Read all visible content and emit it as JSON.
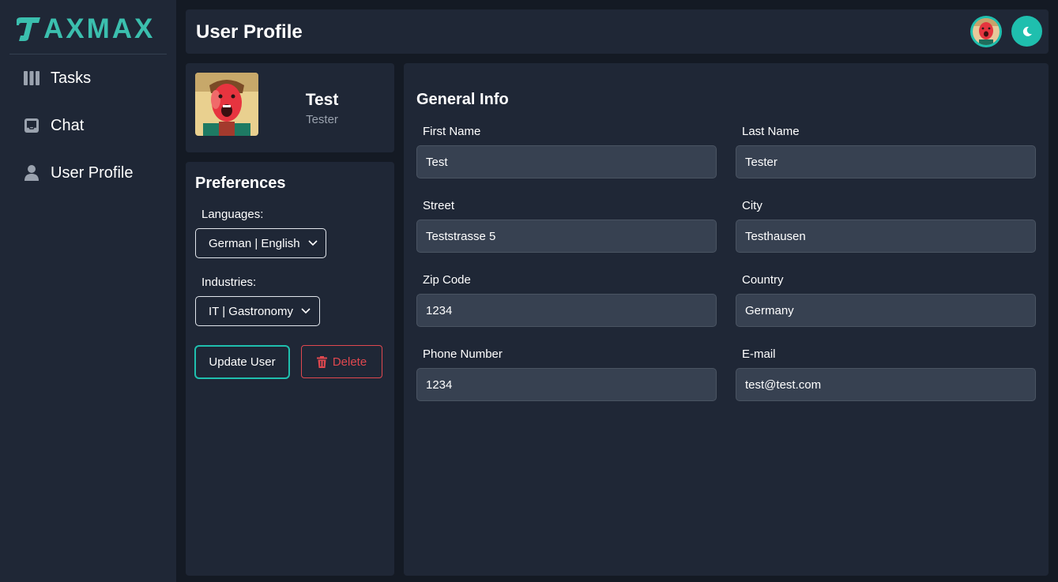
{
  "app": {
    "logo_text": "AXMAX",
    "accent_color": "#1fbfae",
    "danger_color": "#e0484f"
  },
  "sidebar": {
    "items": [
      {
        "label": "Tasks",
        "icon": "columns-icon"
      },
      {
        "label": "Chat",
        "icon": "inbox-icon"
      },
      {
        "label": "User Profile",
        "icon": "user-icon"
      }
    ]
  },
  "header": {
    "title": "User Profile",
    "theme_icon": "moon-icon"
  },
  "profile": {
    "name": "Test",
    "role": "Tester"
  },
  "preferences": {
    "title": "Preferences",
    "languages_label": "Languages:",
    "languages_value": "German | English",
    "industries_label": "Industries:",
    "industries_value": "IT | Gastronomy",
    "update_label": "Update User",
    "delete_label": "Delete"
  },
  "general_info": {
    "title": "General Info",
    "fields": [
      {
        "label": "First Name",
        "value": "Test"
      },
      {
        "label": "Last Name",
        "value": "Tester"
      },
      {
        "label": "Street",
        "value": "Teststrasse 5"
      },
      {
        "label": "City",
        "value": "Testhausen"
      },
      {
        "label": "Zip Code",
        "value": "1234"
      },
      {
        "label": "Country",
        "value": "Germany"
      },
      {
        "label": "Phone Number",
        "value": "1234"
      },
      {
        "label": "E-mail",
        "value": "test@test.com"
      }
    ]
  }
}
